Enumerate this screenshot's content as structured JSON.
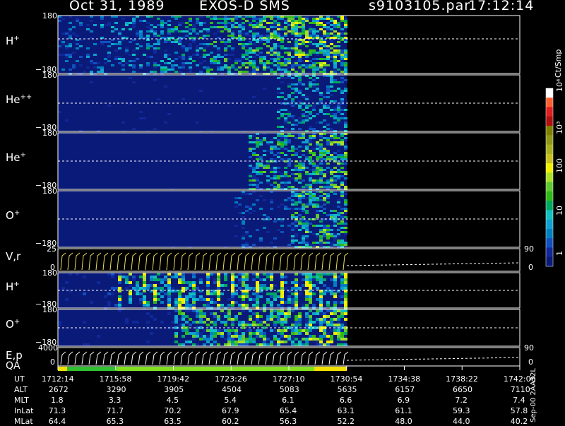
{
  "header": {
    "date": "Oct 31, 1989",
    "instrument": "EXOS-D SMS",
    "file": "s9103105.par",
    "time": "17:12:14"
  },
  "colorbar": {
    "unit_label": "Ct/Smp",
    "labels": [
      "10⁴",
      "10³",
      "100",
      "10",
      "1"
    ],
    "colors": [
      "#ffffff",
      "#ff6030",
      "#e02020",
      "#b01010",
      "#808000",
      "#909818",
      "#a8b020",
      "#c8c020",
      "#f0f000",
      "#a8e028",
      "#60c830",
      "#30b818",
      "#00a860",
      "#10c0c0",
      "#10a0d0",
      "#0080c0",
      "#1050c0",
      "#102898",
      "#0a1a78"
    ]
  },
  "panels": [
    {
      "id": "h-plus-pitch",
      "label": "H",
      "sup": "+",
      "ytop": "180",
      "ybot": "−180"
    },
    {
      "id": "he-pp-pitch",
      "label": "He",
      "sup": "++",
      "ytop": "180",
      "ybot": "−180"
    },
    {
      "id": "he-plus-pitch",
      "label": "He",
      "sup": "+",
      "ytop": "180",
      "ybot": "−180"
    },
    {
      "id": "o-plus-pitch",
      "label": "O",
      "sup": "+",
      "ytop": "180",
      "ybot": "−180"
    },
    {
      "id": "vr-line",
      "label": "V,r",
      "sup": "",
      "ytop": "25",
      "ybot": "0",
      "right_top": "90",
      "right_bot": "0"
    },
    {
      "id": "h-plus-energy",
      "label": "H",
      "sup": "+",
      "ytop": "180",
      "ybot": "−180"
    },
    {
      "id": "o-plus-energy",
      "label": "O",
      "sup": "+",
      "ytop": "180",
      "ybot": "−180"
    },
    {
      "id": "ep-line",
      "label": "E,p",
      "sup": "",
      "ytop": "4000",
      "ybot": "0",
      "right_top": "90",
      "right_bot": "0"
    }
  ],
  "qa": {
    "label": "QA",
    "colors": [
      "#f0e000",
      "#30c030",
      "#80e020",
      "#f0e000"
    ]
  },
  "footer_note": "Sep-00  2AA32L",
  "table": {
    "row_labels": [
      "UT",
      "ALT",
      "MLT",
      "InLat",
      "MLat"
    ],
    "columns": [
      [
        "1712:14",
        "2672",
        "1.8",
        "71.3",
        "64.4"
      ],
      [
        "1715:58",
        "3290",
        "3.3",
        "71.7",
        "65.3"
      ],
      [
        "1719:42",
        "3905",
        "4.5",
        "70.2",
        "63.5"
      ],
      [
        "1723:26",
        "4504",
        "5.4",
        "67.9",
        "60.2"
      ],
      [
        "1727:10",
        "5083",
        "6.1",
        "65.4",
        "56.3"
      ],
      [
        "1730:54",
        "5635",
        "6.6",
        "63.1",
        "52.2"
      ],
      [
        "1734:38",
        "6157",
        "6.9",
        "61.1",
        "48.0"
      ],
      [
        "1738:22",
        "6650",
        "7.2",
        "59.3",
        "44.0"
      ],
      [
        "1742:06",
        "7110",
        "7.4",
        "57.8",
        "40.2"
      ]
    ]
  },
  "chart_data": {
    "type": "heatmap",
    "title": "Oct 31, 1989   EXOS-D SMS",
    "x_ticks": [
      "1712:14",
      "1715:58",
      "1719:42",
      "1723:26",
      "1727:10",
      "1730:54",
      "1734:38",
      "1738:22",
      "1742:06"
    ],
    "data_end_time": "1730:54",
    "series": [
      {
        "name": "H+",
        "ylim": [
          -180,
          180
        ]
      },
      {
        "name": "He++",
        "ylim": [
          -180,
          180
        ]
      },
      {
        "name": "He+",
        "ylim": [
          -180,
          180
        ]
      },
      {
        "name": "O+",
        "ylim": [
          -180,
          180
        ]
      },
      {
        "name": "V,r",
        "ylim": [
          0,
          25
        ]
      },
      {
        "name": "H+",
        "ylim": [
          -180,
          180
        ]
      },
      {
        "name": "O+",
        "ylim": [
          -180,
          180
        ]
      },
      {
        "name": "E,p",
        "ylim": [
          0,
          4000
        ]
      }
    ],
    "colorbar_scale": "log",
    "colorbar_range": [
      1,
      10000
    ]
  }
}
